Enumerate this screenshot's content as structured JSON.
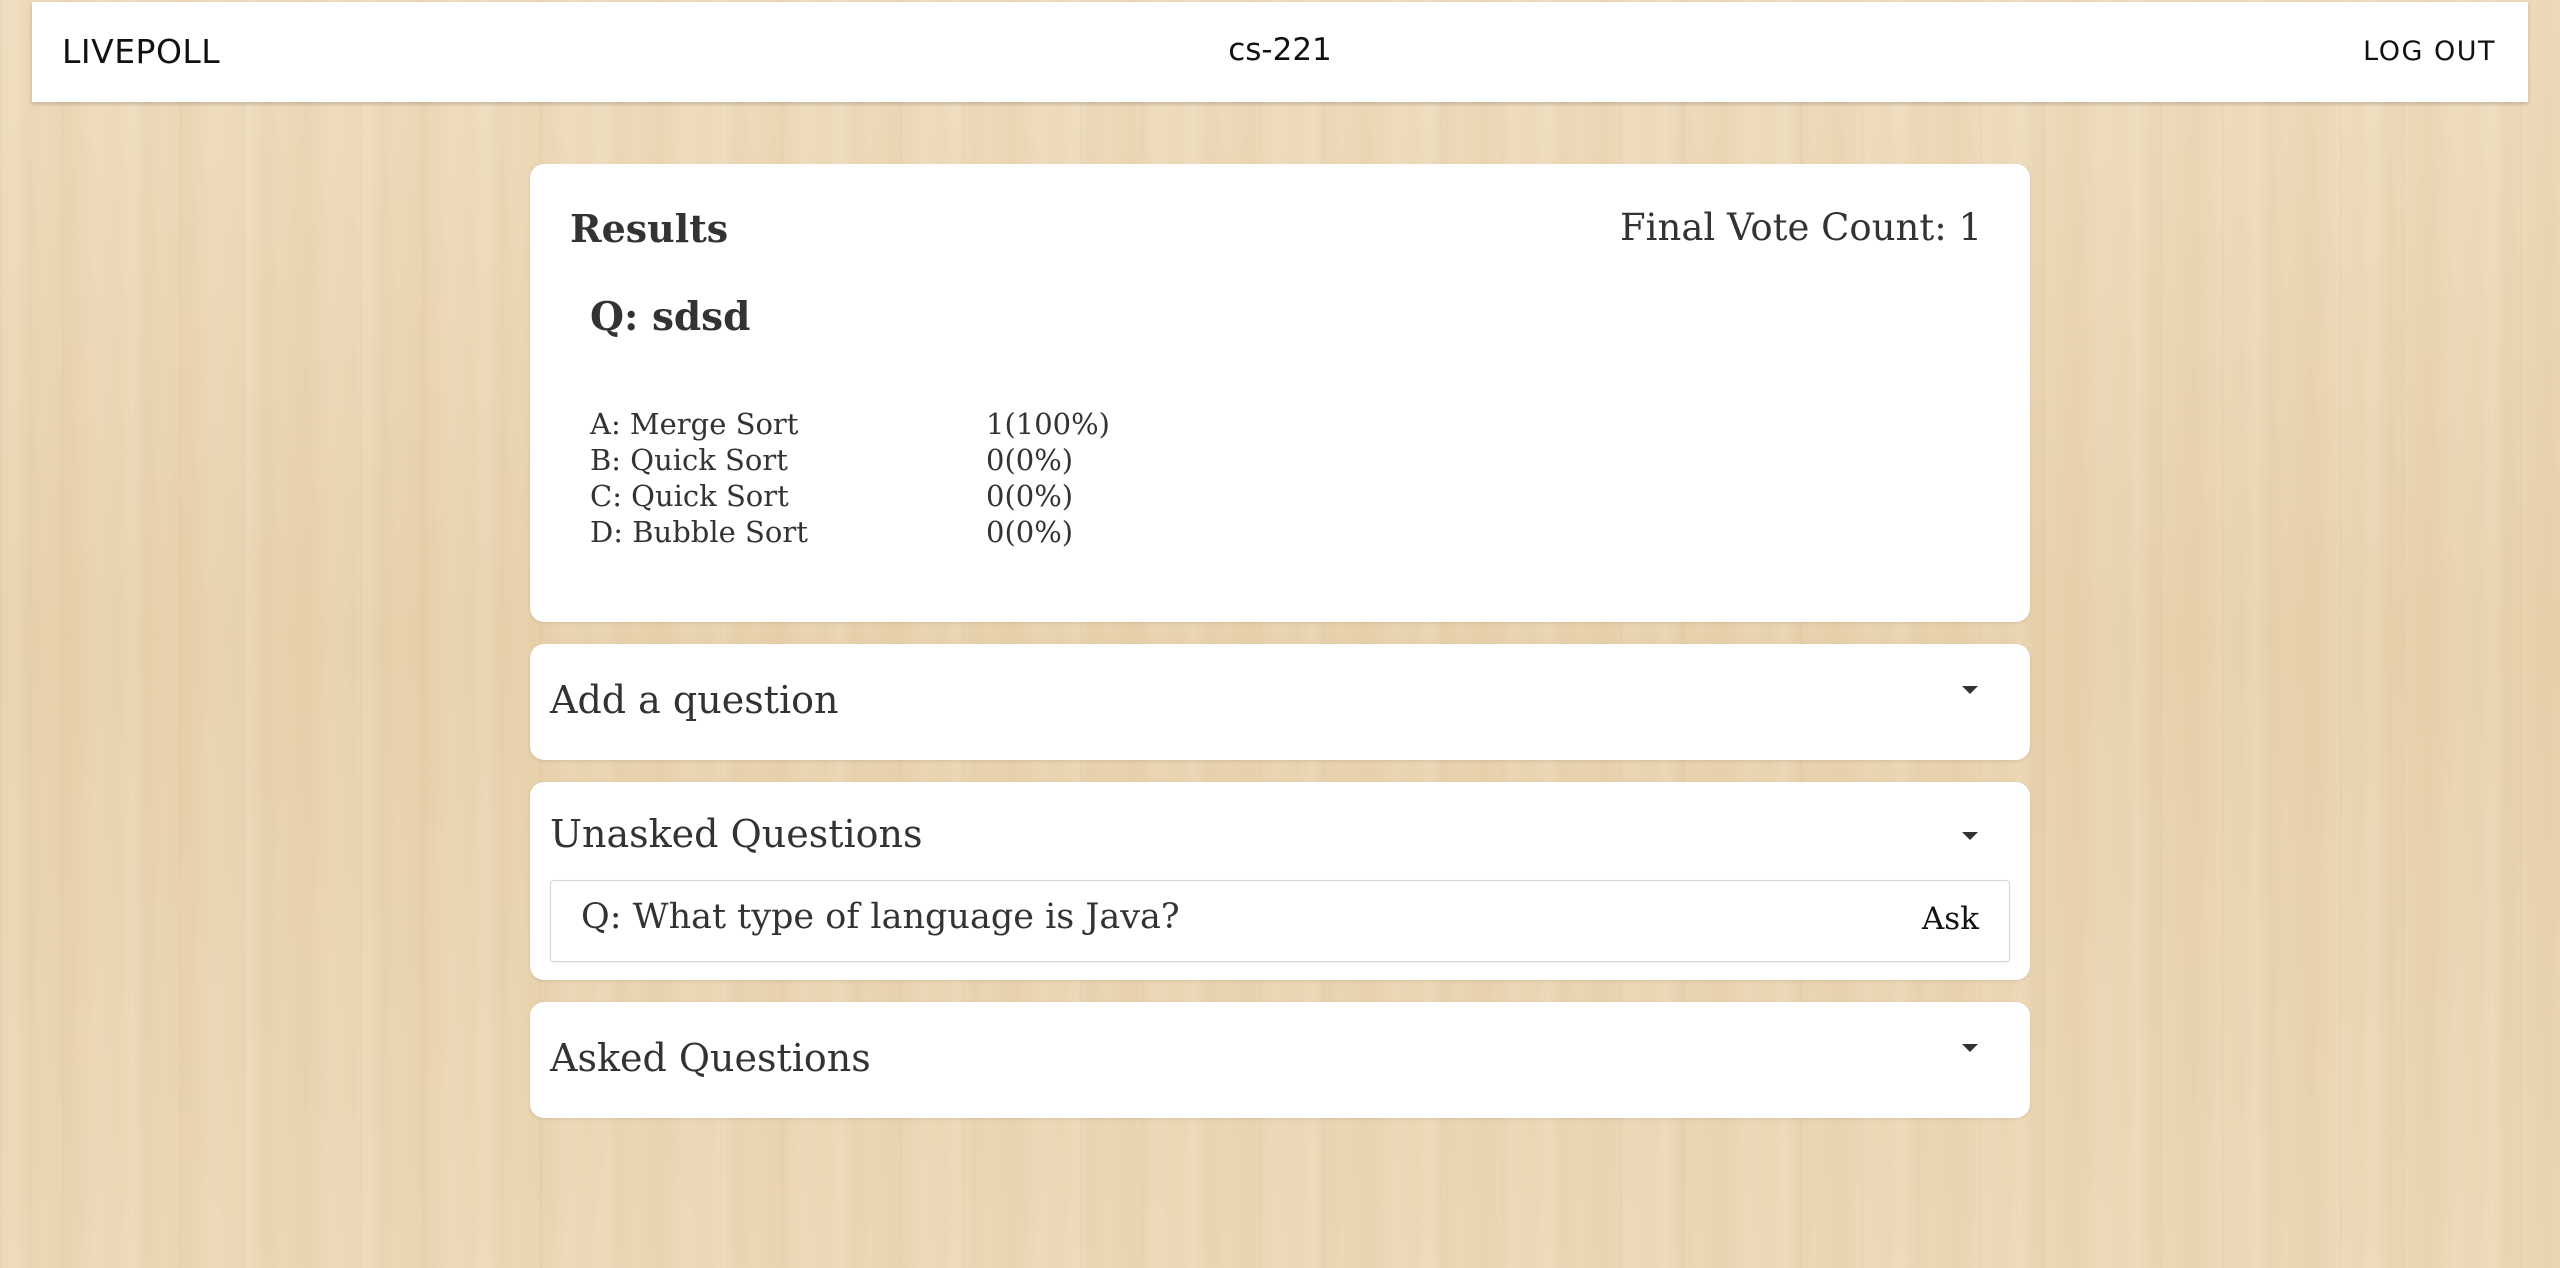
{
  "navbar": {
    "brand": "LIVEPOLL",
    "course": "cs-221",
    "logout_label": "LOG OUT"
  },
  "results": {
    "title": "Results",
    "vote_count_label": "Final Vote Count: 1",
    "question": "Q: sdsd",
    "answers": [
      {
        "label": "A: Merge Sort",
        "count": "1(100%)"
      },
      {
        "label": "B: Quick Sort",
        "count": "0(0%)"
      },
      {
        "label": "C: Quick Sort",
        "count": "0(0%)"
      },
      {
        "label": "D: Bubble Sort",
        "count": "0(0%)"
      }
    ]
  },
  "add_question": {
    "title": "Add a question",
    "icon": "caret-down-icon"
  },
  "unasked": {
    "title": "Unasked Questions",
    "icon": "caret-down-icon",
    "items": [
      {
        "question": "Q: What type of language is Java?",
        "action_label": "Ask"
      }
    ]
  },
  "asked": {
    "title": "Asked Questions",
    "icon": "caret-down-icon"
  }
}
